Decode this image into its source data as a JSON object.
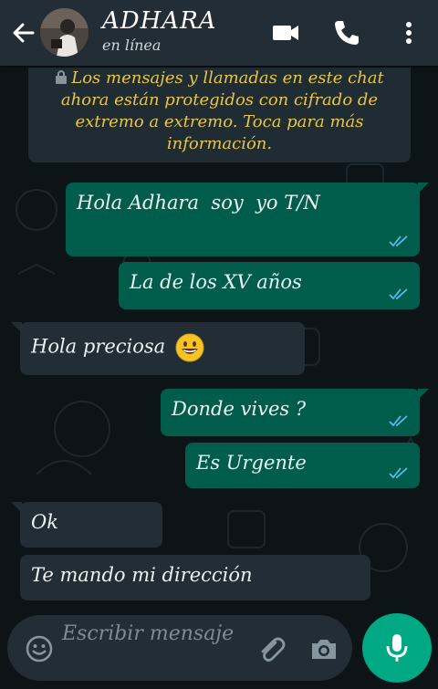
{
  "header": {
    "contact_name": "ADHARA",
    "status": "en línea",
    "icons": [
      "back-arrow-icon",
      "video-call-icon",
      "phone-icon",
      "more-options-icon"
    ]
  },
  "encryption_notice": {
    "icon": "lock-icon",
    "text": "Los mensajes y llamadas en este chat ahora están protegidos con cifrado de extremo a extremo. Toca para más información."
  },
  "messages": [
    {
      "direction": "outgoing",
      "text": "Hola Adhara  soy  yo T/N",
      "status": "read"
    },
    {
      "direction": "outgoing",
      "text": "La de los XV años",
      "status": "read"
    },
    {
      "direction": "incoming",
      "text": "Hola preciosa",
      "emoji": "grinning-face-emoji"
    },
    {
      "direction": "outgoing",
      "text": "Donde vives ?",
      "status": "read"
    },
    {
      "direction": "outgoing",
      "text": "Es Urgente",
      "status": "read"
    },
    {
      "direction": "incoming",
      "text": "Ok"
    },
    {
      "direction": "incoming",
      "text": "Te mando mi dirección"
    }
  ],
  "input": {
    "placeholder": "Escribir mensaje",
    "icons": [
      "emoji-icon",
      "attach-icon",
      "camera-icon",
      "mic-icon"
    ]
  },
  "colors": {
    "header_bg": "#232d36",
    "chat_bg": "#0d1418",
    "outgoing_bubble": "#005d4b",
    "incoming_bubble": "#232d36",
    "notice_text": "#e8c547",
    "read_ticks": "#53bdeb",
    "mic_button": "#00a884"
  }
}
